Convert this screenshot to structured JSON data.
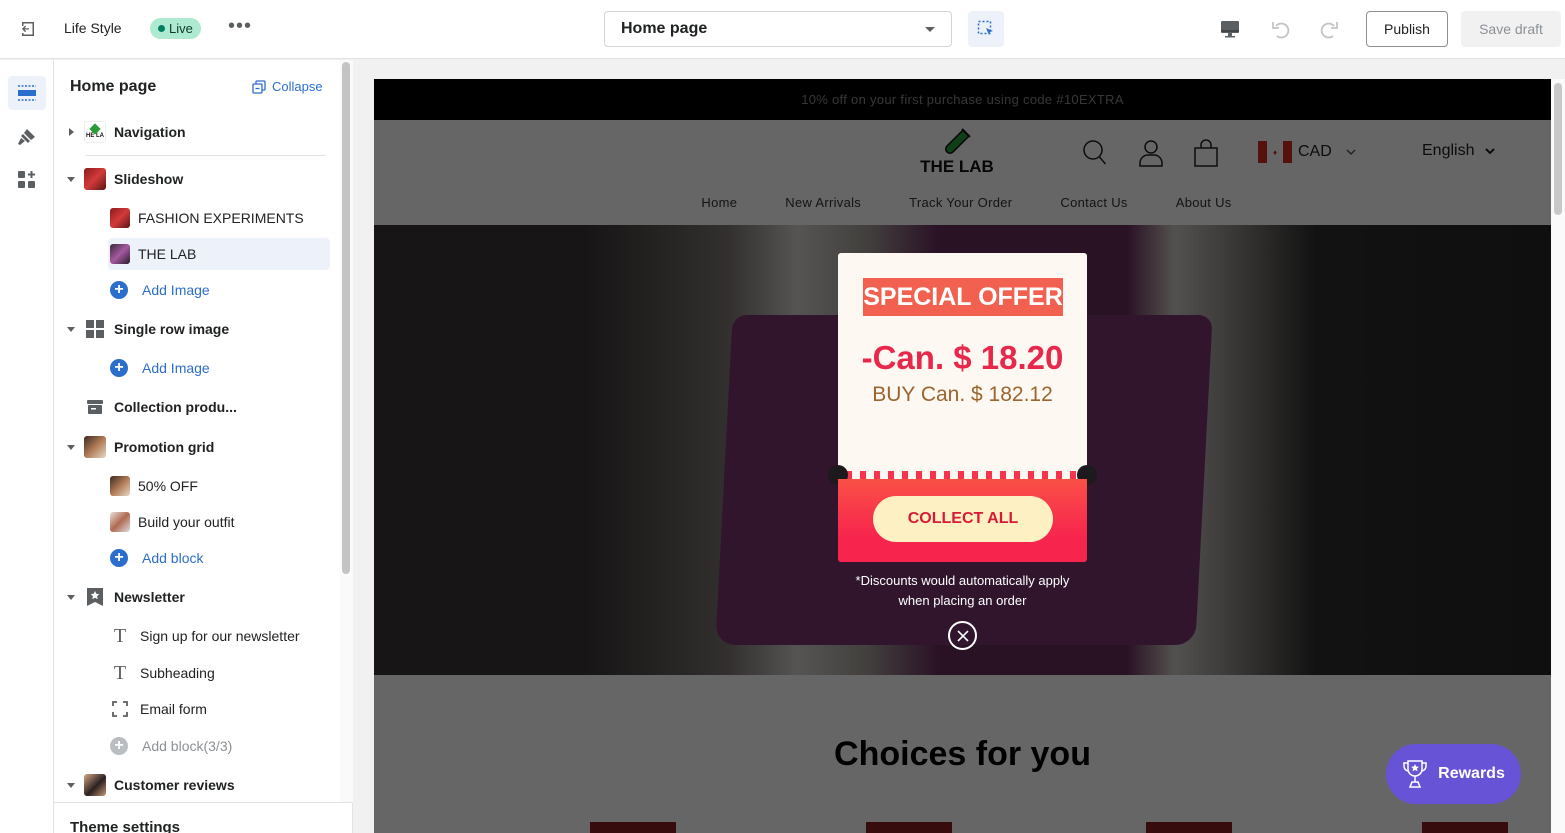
{
  "topbar": {
    "store_name": "Life Style",
    "status_badge": "Live",
    "more_label": "•••",
    "page_select": "Home page",
    "publish_label": "Publish",
    "save_draft_label": "Save draft"
  },
  "sidebar": {
    "title": "Home page",
    "collapse_label": "Collapse",
    "sections": [
      {
        "label": "Navigation",
        "expanded": false
      },
      {
        "label": "Slideshow",
        "expanded": true,
        "blocks": [
          {
            "label": "FASHION EXPERIMENTS"
          },
          {
            "label": "THE LAB",
            "selected": true
          },
          {
            "label": "Add Image",
            "type": "add"
          }
        ]
      },
      {
        "label": "Single row image",
        "expanded": true,
        "blocks": [
          {
            "label": "Add Image",
            "type": "add"
          }
        ]
      },
      {
        "label": "Collection produ..."
      },
      {
        "label": "Promotion grid",
        "expanded": true,
        "blocks": [
          {
            "label": "50% OFF"
          },
          {
            "label": "Build your outfit"
          },
          {
            "label": "Add block",
            "type": "add"
          }
        ]
      },
      {
        "label": "Newsletter",
        "expanded": true,
        "blocks": [
          {
            "label": "Sign up for our newsletter"
          },
          {
            "label": "Subheading"
          },
          {
            "label": "Email form"
          },
          {
            "label": "Add block(3/3)",
            "type": "add-disabled"
          }
        ]
      },
      {
        "label": "Customer reviews",
        "expanded": true
      }
    ],
    "theme_settings": "Theme settings"
  },
  "storefront": {
    "announcement": "10% off on your first purchase using code #10EXTRA",
    "logo_text": "THE LAB",
    "currency": "CAD",
    "language": "English",
    "nav": [
      "Home",
      "New Arrivals",
      "Track Your Order",
      "Contact Us",
      "About Us"
    ],
    "section_heading": "Choices for you"
  },
  "popup": {
    "badge": "SPECIAL OFFER",
    "discount": "-Can. $ 18.20",
    "condition": "BUY Can. $ 182.12",
    "button": "COLLECT ALL",
    "note_line1": "*Discounts would automatically apply",
    "note_line2": "when placing an order"
  },
  "rewards_label": "Rewards",
  "colors": {
    "accent": "#2c6ecb",
    "live_badge": "#aee9d1",
    "offer_badge": "#f2614f",
    "discount_text": "#e8284a",
    "coupon_red": "#f7254d",
    "rewards": "#6753d6"
  }
}
